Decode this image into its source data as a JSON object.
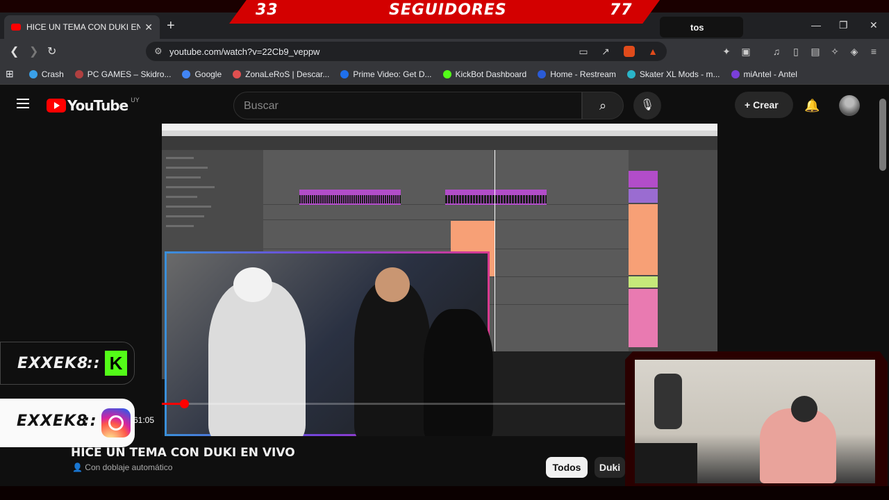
{
  "overlay": {
    "left_count": "33",
    "label": "SEGUIDORES",
    "right_count": "77"
  },
  "browser": {
    "tab_title": "HICE UN TEMA CON DUKI EN VIVO",
    "new_tab": "+",
    "profile_chip_text": "tos",
    "url": "youtube.com/watch?v=22Cb9_veppw",
    "bookmarks": [
      {
        "label": "Crash",
        "color": "#3aa0e8"
      },
      {
        "label": "PC GAMES – Skidro...",
        "color": "#b04040"
      },
      {
        "label": "Google",
        "color": "#4285f4"
      },
      {
        "label": "ZonaLeRoS | Descar...",
        "color": "#e05050"
      },
      {
        "label": "Prime Video: Get D...",
        "color": "#1f6feb"
      },
      {
        "label": "KickBot Dashboard",
        "color": "#53fc18"
      },
      {
        "label": "Home - Restream",
        "color": "#2a5bd7"
      },
      {
        "label": "Skater XL Mods - m...",
        "color": "#2ab5c9"
      },
      {
        "label": "miAntel - Antel",
        "color": "#7a3fd9"
      }
    ]
  },
  "youtube": {
    "logo_text": "YouTube",
    "region": "UY",
    "search_placeholder": "Buscar",
    "create_label": "Crear",
    "video_title": "HICE UN TEMA CON DUKI EN VIVO",
    "dub_label": "Con doblaje automático",
    "time_display": "61:05",
    "progress_fraction": 0.04,
    "chips": [
      {
        "label": "Todos"
      },
      {
        "label": "Duki"
      }
    ]
  },
  "overlay_widgets": {
    "kick_name": "EXXEK8",
    "kick_sep": "::",
    "kick_logo": "K",
    "ig_name": "EXXEK8",
    "ig_sep": "::"
  },
  "colors": {
    "youtube_red": "#ff0000",
    "overlay_red": "#d30000",
    "kick_green": "#53fc18"
  }
}
